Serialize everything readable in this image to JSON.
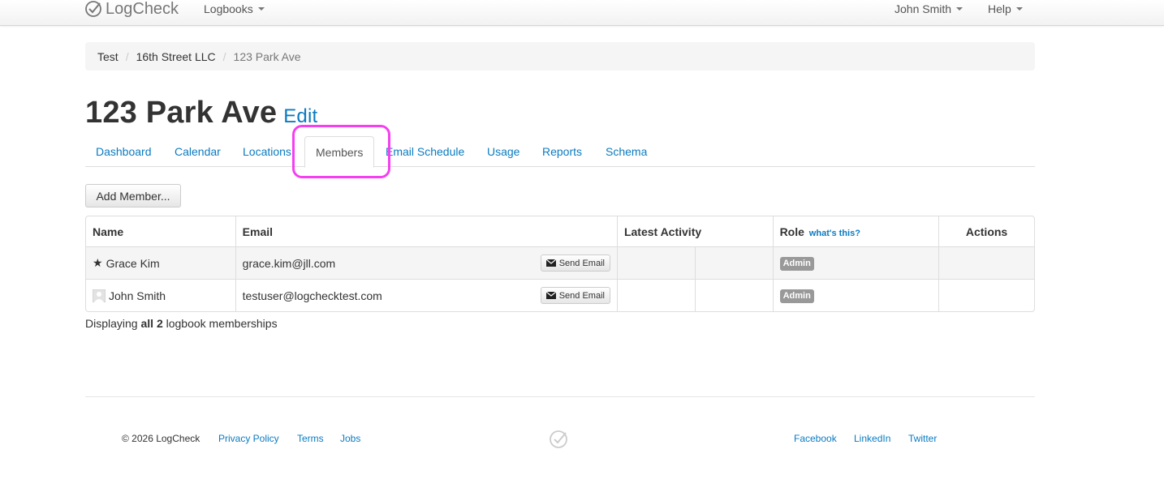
{
  "navbar": {
    "brand": "LogCheck",
    "logbooks_label": "Logbooks",
    "user_label": "John Smith",
    "help_label": "Help"
  },
  "breadcrumb": {
    "items": [
      "Test",
      "16th Street LLC"
    ],
    "active": "123 Park Ave"
  },
  "page": {
    "title": "123 Park Ave",
    "edit_label": "Edit"
  },
  "tabs": [
    {
      "label": "Dashboard"
    },
    {
      "label": "Calendar"
    },
    {
      "label": "Locations"
    },
    {
      "label": "Members"
    },
    {
      "label": "Email Schedule"
    },
    {
      "label": "Usage"
    },
    {
      "label": "Reports"
    },
    {
      "label": "Schema"
    }
  ],
  "active_tab": "Members",
  "add_member_label": "Add Member...",
  "table": {
    "headers": {
      "name": "Name",
      "email": "Email",
      "latest_activity": "Latest Activity",
      "role": "Role",
      "role_help": "what's this?",
      "actions": "Actions"
    },
    "rows": [
      {
        "name": "Grace Kim",
        "email": "grace.kim@jll.com",
        "send_label": "Send Email",
        "role": "Admin",
        "icon": "star-icon"
      },
      {
        "name": "John Smith",
        "email": "testuser@logchecktest.com",
        "send_label": "Send Email",
        "role": "Admin",
        "icon": "avatar-placeholder-icon"
      }
    ]
  },
  "summary": {
    "prefix": "Displaying",
    "strong": "all 2",
    "suffix": "logbook memberships"
  },
  "footer": {
    "copyright": "© 2026 LogCheck",
    "links_left": [
      "Privacy Policy",
      "Terms",
      "Jobs"
    ],
    "links_right": [
      "Facebook",
      "LinkedIn",
      "Twitter"
    ]
  },
  "colors": {
    "link": "#0a7bc1",
    "highlight": "#f53ff0",
    "badge": "#999999"
  }
}
